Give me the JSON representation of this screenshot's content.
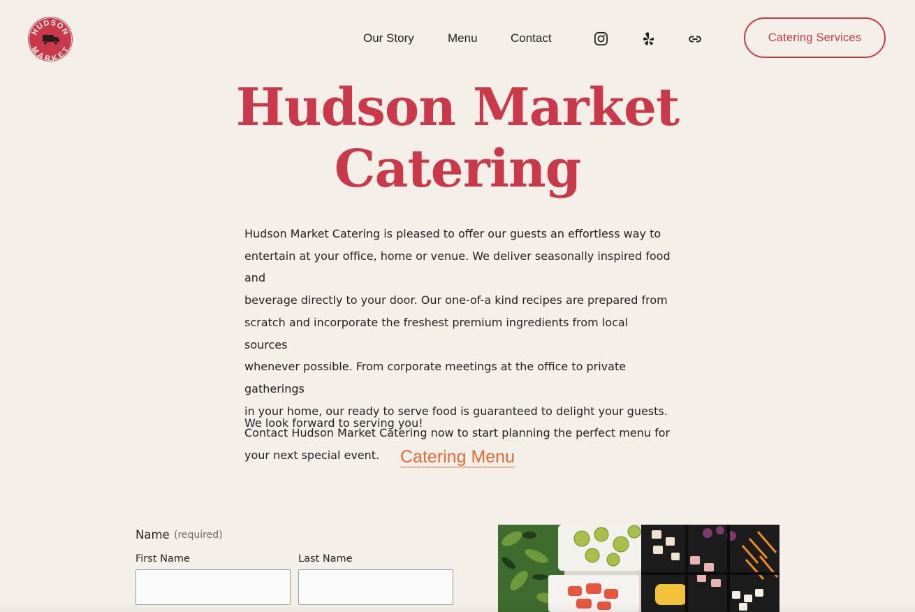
{
  "header": {
    "logo_top": "HUDSON",
    "logo_bottom": "MARKET",
    "nav": [
      "Our Story",
      "Menu",
      "Contact"
    ],
    "social": [
      "instagram-icon",
      "yelp-icon",
      "link-icon"
    ],
    "cta_label": "Catering Services"
  },
  "hero": {
    "title_line1": "Hudson Market",
    "title_line2": "Catering",
    "intro_lines": [
      "Hudson Market Catering is pleased to offer our guests an effortless way to",
      "entertain at your office, home or venue. We deliver seasonally inspired food and",
      "beverage directly to your door. Our one-of-a kind recipes are prepared from",
      "scratch and incorporate the freshest premium ingredients from local sources",
      "whenever possible. From corporate meetings at the office to private gatherings",
      "in your home, our ready to serve food is guaranteed to delight your guests.",
      "Contact Hudson Market Catering now to start planning the perfect menu for",
      "your next special event."
    ],
    "closing": "We look forward to serving you!",
    "menu_link": "Catering Menu"
  },
  "form": {
    "name_label": "Name",
    "required_label": "(required)",
    "first_name_label": "First Name",
    "last_name_label": "Last Name",
    "first_name_value": "",
    "last_name_value": ""
  },
  "colors": {
    "background": "#f4f0e9",
    "brand_red": "#c9394a",
    "link_orange": "#e46a36"
  }
}
